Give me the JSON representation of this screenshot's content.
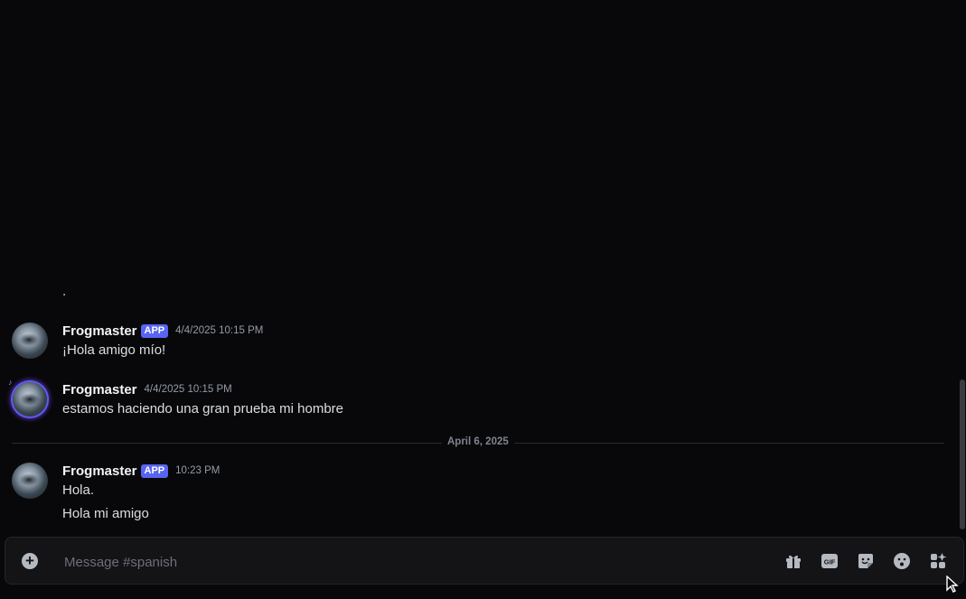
{
  "messages": {
    "orphan_line": ".",
    "group1": {
      "username": "Frogmaster",
      "badge": "APP",
      "timestamp": "4/4/2025 10:15 PM",
      "lines": [
        "¡Hola amigo mío!"
      ]
    },
    "group2": {
      "username": "Frogmaster",
      "timestamp": "4/4/2025 10:15 PM",
      "lines": [
        "estamos haciendo una gran prueba mi hombre"
      ]
    },
    "divider": "April 6, 2025",
    "group3": {
      "username": "Frogmaster",
      "badge": "APP",
      "timestamp": "10:23 PM",
      "lines": [
        "Hola.",
        "Hola mi amigo"
      ]
    }
  },
  "composer": {
    "placeholder": "Message #spanish",
    "value": "",
    "gif_label": "GIF",
    "tools": [
      "gift-icon",
      "gif-icon",
      "sticker-icon",
      "emoji-icon",
      "apps-icon"
    ]
  },
  "colors": {
    "background": "#08080a",
    "badge": "#5865f2",
    "composer_bg": "#141417"
  }
}
